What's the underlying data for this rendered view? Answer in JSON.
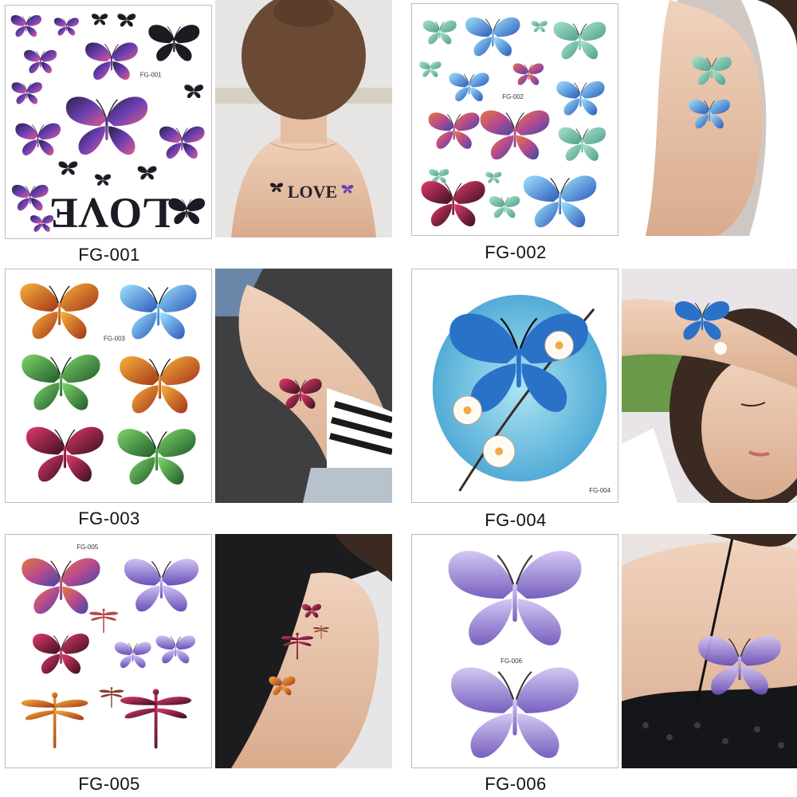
{
  "products": [
    {
      "code": "FG-001",
      "sheet_code": "FG-001",
      "sheet_text": "LOVE",
      "photo_text": "LOVE"
    },
    {
      "code": "FG-002",
      "sheet_code": "FG-002"
    },
    {
      "code": "FG-003",
      "sheet_code": "FG-003"
    },
    {
      "code": "FG-004",
      "sheet_code": "FG-004"
    },
    {
      "code": "FG-005",
      "sheet_code": "FG-005"
    },
    {
      "code": "FG-006",
      "sheet_code": "FG-006"
    }
  ],
  "colors": {
    "glitter_purple": "#5b3fa0",
    "glitter_black": "#1e1a24",
    "teal": "#7ecab0",
    "skin": "#e9c6ae",
    "watercolor_blue": "#3aa6d6",
    "fairy_violet": "#9b86d6"
  }
}
